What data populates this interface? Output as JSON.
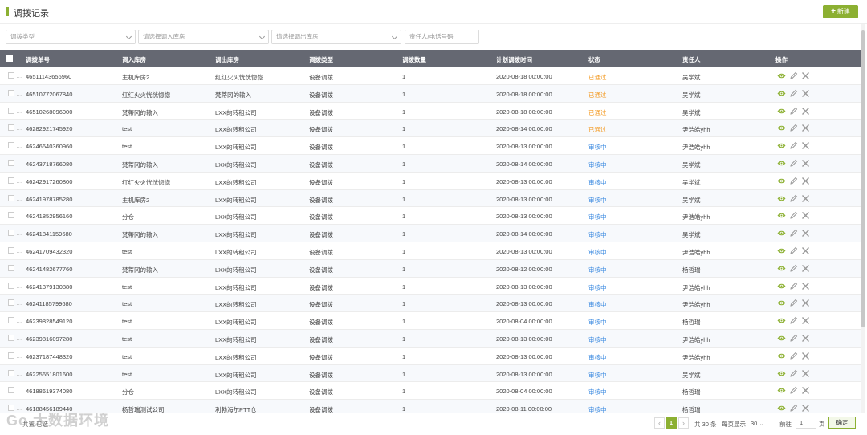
{
  "page": {
    "title": "调拨记录",
    "new_label": "新建"
  },
  "filters": {
    "type_placeholder": "调拨类型",
    "in_placeholder": "请选择调入库房",
    "out_placeholder": "请选择调出库房",
    "person_placeholder": "责任人/电话号码"
  },
  "columns": [
    "调拨单号",
    "调入库房",
    "调出库房",
    "调拨类型",
    "调拨数量",
    "计划调拨时间",
    "状态",
    "责任人",
    "操作"
  ],
  "rows": [
    {
      "id": "46511143656960",
      "in": "主机库房2",
      "out": "红红火火恍恍惚惚",
      "type": "设备调拨",
      "qty": "1",
      "time": "2020-08-18 00:00:00",
      "status": "已通过",
      "status_kind": "pass",
      "person": "吴学斌"
    },
    {
      "id": "46510772067840",
      "in": "红红火火恍恍惚惚",
      "out": "梵蒂冈的输入",
      "type": "设备调拨",
      "qty": "1",
      "time": "2020-08-18 00:00:00",
      "status": "已通过",
      "status_kind": "pass",
      "person": "吴学斌"
    },
    {
      "id": "46510268096000",
      "in": "梵蒂冈的输入",
      "out": "LXX的转租公司",
      "type": "设备调拨",
      "qty": "1",
      "time": "2020-08-18 00:00:00",
      "status": "已通过",
      "status_kind": "pass",
      "person": "吴学斌"
    },
    {
      "id": "46282921745920",
      "in": "test",
      "out": "LXX的转租公司",
      "type": "设备调拨",
      "qty": "1",
      "time": "2020-08-14 00:00:00",
      "status": "已通过",
      "status_kind": "pass",
      "person": "尹浩皓yhh"
    },
    {
      "id": "46246640360960",
      "in": "test",
      "out": "LXX的转租公司",
      "type": "设备调拨",
      "qty": "1",
      "time": "2020-08-13 00:00:00",
      "status": "审核中",
      "status_kind": "review",
      "person": "尹浩皓yhh"
    },
    {
      "id": "46243718766080",
      "in": "梵蒂冈的输入",
      "out": "LXX的转租公司",
      "type": "设备调拨",
      "qty": "1",
      "time": "2020-08-14 00:00:00",
      "status": "审核中",
      "status_kind": "review",
      "person": "吴学斌"
    },
    {
      "id": "46242917260800",
      "in": "红红火火恍恍惚惚",
      "out": "LXX的转租公司",
      "type": "设备调拨",
      "qty": "1",
      "time": "2020-08-13 00:00:00",
      "status": "审核中",
      "status_kind": "review",
      "person": "吴学斌"
    },
    {
      "id": "46241978785280",
      "in": "主机库房2",
      "out": "LXX的转租公司",
      "type": "设备调拨",
      "qty": "1",
      "time": "2020-08-13 00:00:00",
      "status": "审核中",
      "status_kind": "review",
      "person": "吴学斌"
    },
    {
      "id": "46241852956160",
      "in": "分仓",
      "out": "LXX的转租公司",
      "type": "设备调拨",
      "qty": "1",
      "time": "2020-08-13 00:00:00",
      "status": "审核中",
      "status_kind": "review",
      "person": "尹浩皓yhh"
    },
    {
      "id": "46241841159680",
      "in": "梵蒂冈的输入",
      "out": "LXX的转租公司",
      "type": "设备调拨",
      "qty": "1",
      "time": "2020-08-14 00:00:00",
      "status": "审核中",
      "status_kind": "review",
      "person": "吴学斌"
    },
    {
      "id": "46241709432320",
      "in": "test",
      "out": "LXX的转租公司",
      "type": "设备调拨",
      "qty": "1",
      "time": "2020-08-13 00:00:00",
      "status": "审核中",
      "status_kind": "review",
      "person": "尹浩皓yhh"
    },
    {
      "id": "46241482677760",
      "in": "梵蒂冈的输入",
      "out": "LXX的转租公司",
      "type": "设备调拨",
      "qty": "1",
      "time": "2020-08-12 00:00:00",
      "status": "审核中",
      "status_kind": "review",
      "person": "杨哲瑞"
    },
    {
      "id": "46241379130880",
      "in": "test",
      "out": "LXX的转租公司",
      "type": "设备调拨",
      "qty": "1",
      "time": "2020-08-13 00:00:00",
      "status": "审核中",
      "status_kind": "review",
      "person": "尹浩皓yhh"
    },
    {
      "id": "46241185799680",
      "in": "test",
      "out": "LXX的转租公司",
      "type": "设备调拨",
      "qty": "1",
      "time": "2020-08-13 00:00:00",
      "status": "审核中",
      "status_kind": "review",
      "person": "尹浩皓yhh"
    },
    {
      "id": "46239828549120",
      "in": "test",
      "out": "LXX的转租公司",
      "type": "设备调拨",
      "qty": "1",
      "time": "2020-08-04 00:00:00",
      "status": "审核中",
      "status_kind": "review",
      "person": "杨哲瑞"
    },
    {
      "id": "46239816097280",
      "in": "test",
      "out": "LXX的转租公司",
      "type": "设备调拨",
      "qty": "1",
      "time": "2020-08-13 00:00:00",
      "status": "审核中",
      "status_kind": "review",
      "person": "尹浩皓yhh"
    },
    {
      "id": "46237187448320",
      "in": "test",
      "out": "LXX的转租公司",
      "type": "设备调拨",
      "qty": "1",
      "time": "2020-08-13 00:00:00",
      "status": "审核中",
      "status_kind": "review",
      "person": "尹浩皓yhh"
    },
    {
      "id": "46225651801600",
      "in": "test",
      "out": "LXX的转租公司",
      "type": "设备调拨",
      "qty": "1",
      "time": "2020-08-13 00:00:00",
      "status": "审核中",
      "status_kind": "review",
      "person": "吴学斌"
    },
    {
      "id": "46188619374080",
      "in": "分仓",
      "out": "LXX的转租公司",
      "type": "设备调拨",
      "qty": "1",
      "time": "2020-08-04 00:00:00",
      "status": "审核中",
      "status_kind": "review",
      "person": "杨哲瑞"
    },
    {
      "id": "46188456189440",
      "in": "杨哲瑞测试公司",
      "out": "利勃海尔PTT仓",
      "type": "设备调拨",
      "qty": "1",
      "time": "2020-08-11 00:00:00",
      "status": "审核中",
      "status_kind": "review",
      "person": "杨哲瑞"
    }
  ],
  "pagination": {
    "current": "1",
    "total": "共 30 条",
    "per_page_label": "每页显示",
    "per_page": "30",
    "goto": "前往",
    "goto_value": "1",
    "page_unit": "页",
    "confirm": "确定",
    "footer_left": "共置  已选"
  },
  "watermark": "Go 大数据环境",
  "colors": {
    "accent": "#8cb032",
    "header": "#656872",
    "pass": "#f39b25",
    "review": "#3b8ae0"
  }
}
